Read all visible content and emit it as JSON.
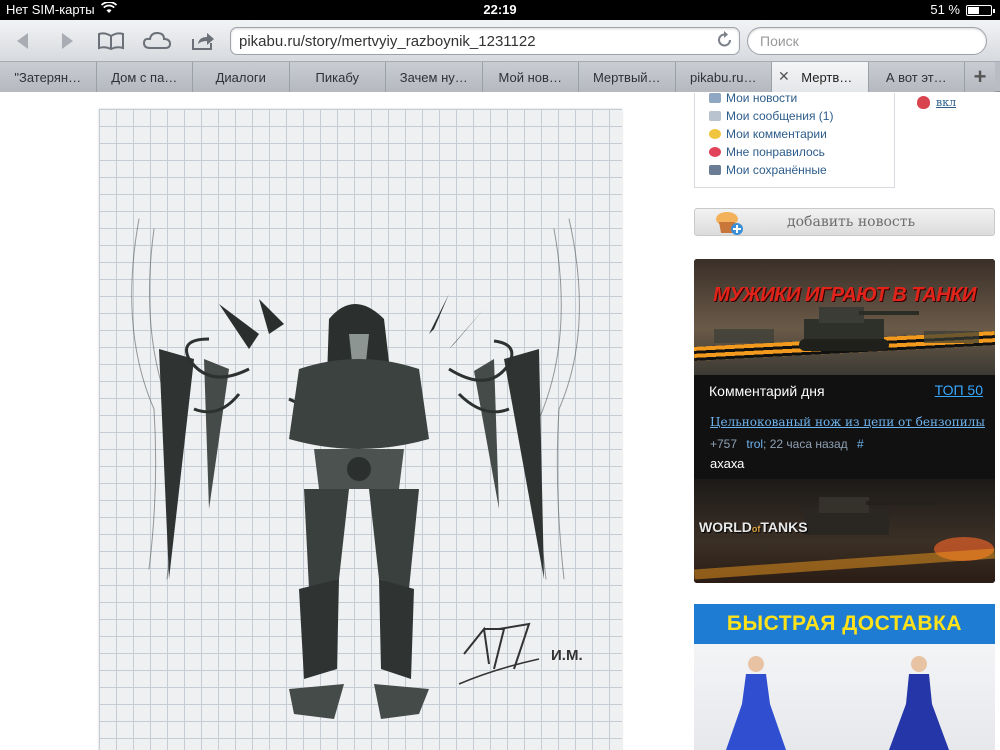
{
  "status_bar": {
    "carrier": "Нет SIM-карты",
    "time": "22:19",
    "battery_text": "51 %",
    "battery_level": 0.51
  },
  "toolbar": {
    "url": "pikabu.ru/story/mertvyiy_razboynik_1231122",
    "search_placeholder": "Поиск"
  },
  "tabs": [
    {
      "label": "\"Затерян…"
    },
    {
      "label": "Дом с па…"
    },
    {
      "label": "Диалоги"
    },
    {
      "label": "Пикабу"
    },
    {
      "label": "Зачем ну…"
    },
    {
      "label": "Мой нов…"
    },
    {
      "label": "Мертвый…"
    },
    {
      "label": "pikabu.ru…"
    },
    {
      "label": "Мертв…"
    },
    {
      "label": "А вот эт…"
    }
  ],
  "new_tab_symbol": "+",
  "sketch": {
    "signature": "И.М."
  },
  "user_menu": [
    {
      "label": "Мои новости",
      "icon": "news-icon",
      "color": "#8fa7c2"
    },
    {
      "label": "Мои сообщения (1)",
      "icon": "envelope-icon",
      "color": "#b8c3cf"
    },
    {
      "label": "Мои комментарии",
      "icon": "speech-bubble-icon",
      "color": "#f0c43c"
    },
    {
      "label": "Мне понравилось",
      "icon": "heart-icon",
      "color": "#e0435a"
    },
    {
      "label": "Мои сохранённые",
      "icon": "floppy-disk-icon",
      "color": "#6b7d94"
    }
  ],
  "vkl_label": "вкл",
  "add_news_label": "добавить новость",
  "tank_ad": {
    "headline": "МУЖИКИ ИГРАЮТ В ТАНКИ",
    "comment_of_day_title": "Комментарий дня",
    "top50_label": "ТОП 50",
    "comment_link": "Цельнокованый нож из цепи от бензопилы",
    "score": "+757",
    "user": "trol",
    "time_ago": "; 22 часа назад",
    "hash": "#",
    "comment_text": "ахаха",
    "logo_part1": "WORLD",
    "logo_part2": "of",
    "logo_part3": "TANKS"
  },
  "delivery_ad": {
    "headline": "БЫСТРАЯ ДОСТАВКА"
  }
}
